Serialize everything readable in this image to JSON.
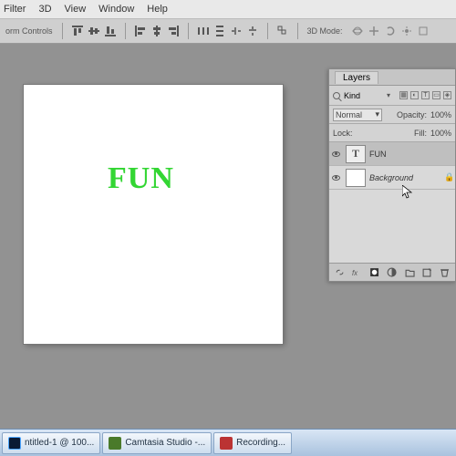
{
  "menu": {
    "items": [
      "Filter",
      "3D",
      "View",
      "Window",
      "Help"
    ]
  },
  "optionsbar": {
    "label": "orm Controls",
    "mode_label": "3D Mode:"
  },
  "canvas": {
    "text": "FUN",
    "text_color": "#33d633"
  },
  "layers_panel": {
    "tab": "Layers",
    "filter_kind": "Kind",
    "blend_mode": "Normal",
    "opacity_label": "Opacity:",
    "opacity_value": "100%",
    "lock_label": "Lock:",
    "fill_label": "Fill:",
    "fill_value": "100%",
    "layers": [
      {
        "name": "FUN",
        "kind": "text",
        "selected": true,
        "locked": false
      },
      {
        "name": "Background",
        "kind": "raster",
        "selected": false,
        "locked": true
      }
    ]
  },
  "taskbar": {
    "items": [
      {
        "label": "ntitled-1 @ 100...",
        "icon": "ps"
      },
      {
        "label": "Camtasia Studio -...",
        "icon": "cam"
      },
      {
        "label": "Recording...",
        "icon": "rec"
      }
    ]
  }
}
